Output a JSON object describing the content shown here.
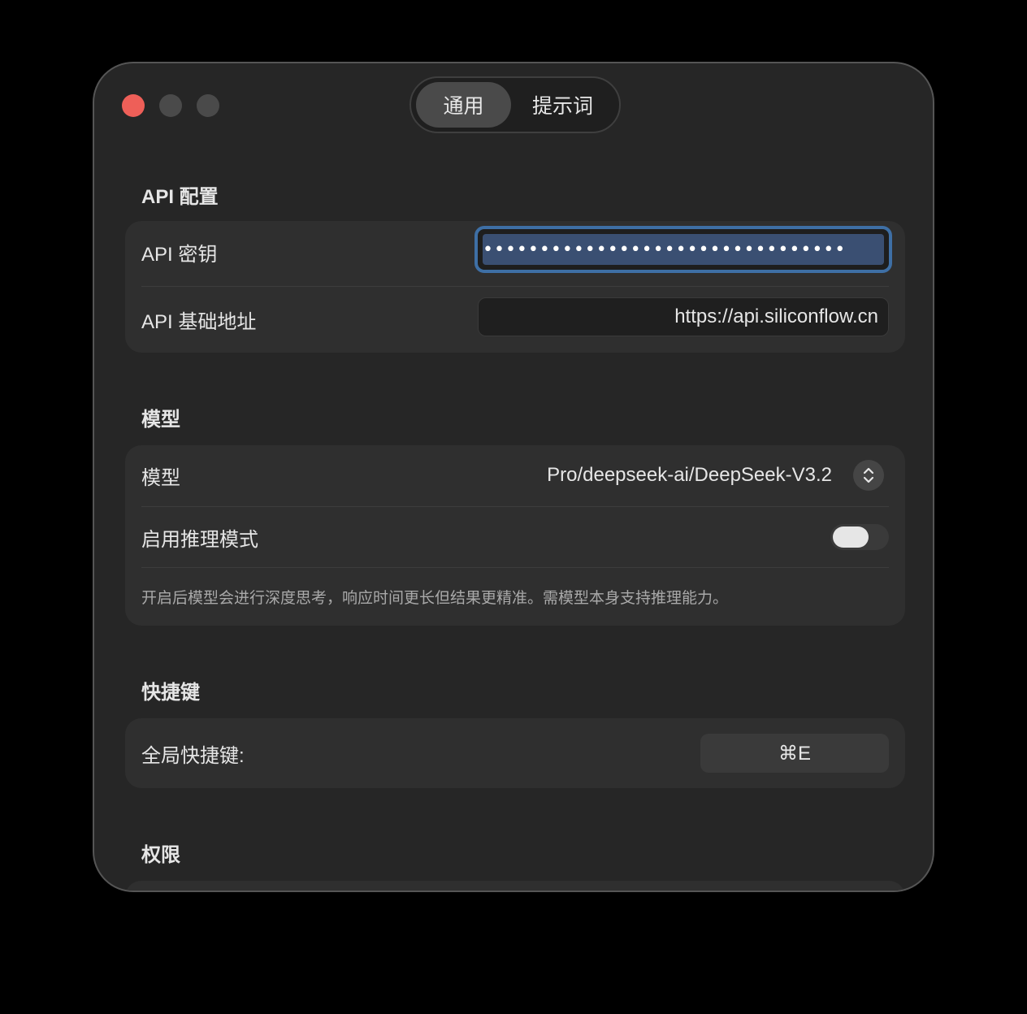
{
  "window": {
    "tabs": [
      {
        "label": "通用",
        "active": true
      },
      {
        "label": "提示词",
        "active": false
      }
    ]
  },
  "api": {
    "section_title": "API 配置",
    "key_label": "API 密钥",
    "key_value": "••••••••••••••••••••••••••••••••",
    "base_url_label": "API 基础地址",
    "base_url_value": "https://api.siliconflow.cn"
  },
  "model": {
    "section_title": "模型",
    "model_label": "模型",
    "model_value": "Pro/deepseek-ai/DeepSeek-V3.2",
    "reasoning_label": "启用推理模式",
    "reasoning_enabled": false,
    "hint": "开启后模型会进行深度思考，响应时间更长但结果更精准。需模型本身支持推理能力。"
  },
  "shortcut": {
    "section_title": "快捷键",
    "global_label": "全局快捷键:",
    "global_value": "⌘E"
  },
  "permissions": {
    "section_title": "权限"
  },
  "colors": {
    "close": "#ee5f58",
    "accent_focus": "#3e6fa5"
  }
}
